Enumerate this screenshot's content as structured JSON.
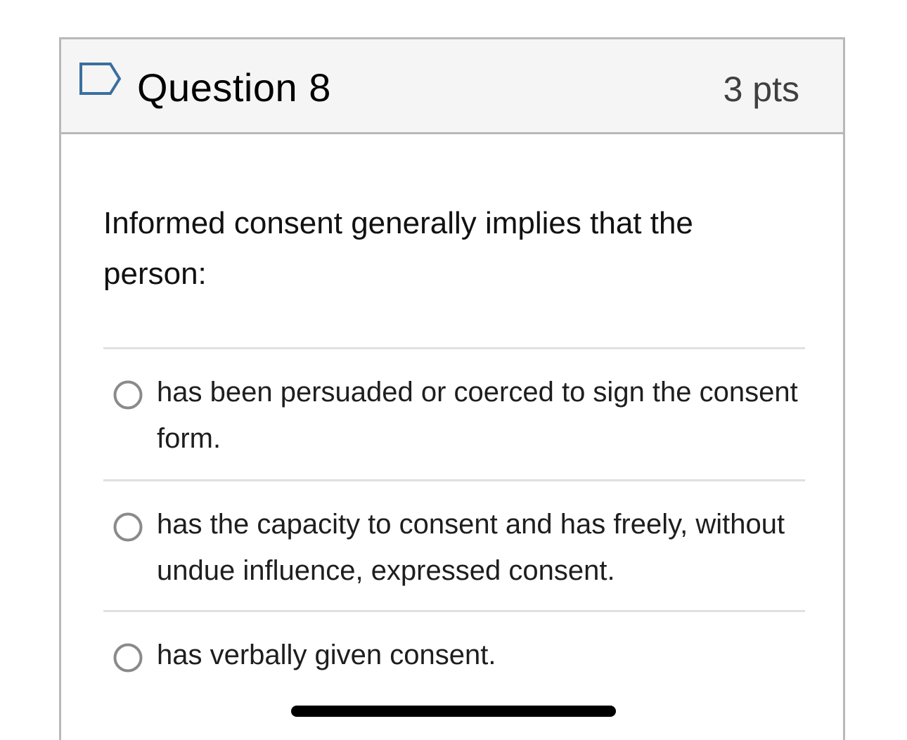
{
  "question": {
    "title": "Question 8",
    "points": "3 pts",
    "text": "Informed consent generally implies that the person:",
    "flag_icon": "flag-bookmark-outline-icon"
  },
  "answers": [
    {
      "label": "has been persuaded or coerced to sign the consent form.",
      "selected": false
    },
    {
      "label": "has the capacity to consent and has freely, without undue influence, expressed consent.",
      "selected": false
    },
    {
      "label": "has verbally given consent.",
      "selected": false
    }
  ],
  "colors": {
    "header_bg": "#f5f5f5",
    "border": "#b8b8b8",
    "divider": "#e0e0e0",
    "flag_stroke": "#3b6f9e",
    "radio_stroke": "#8a8a8a"
  }
}
